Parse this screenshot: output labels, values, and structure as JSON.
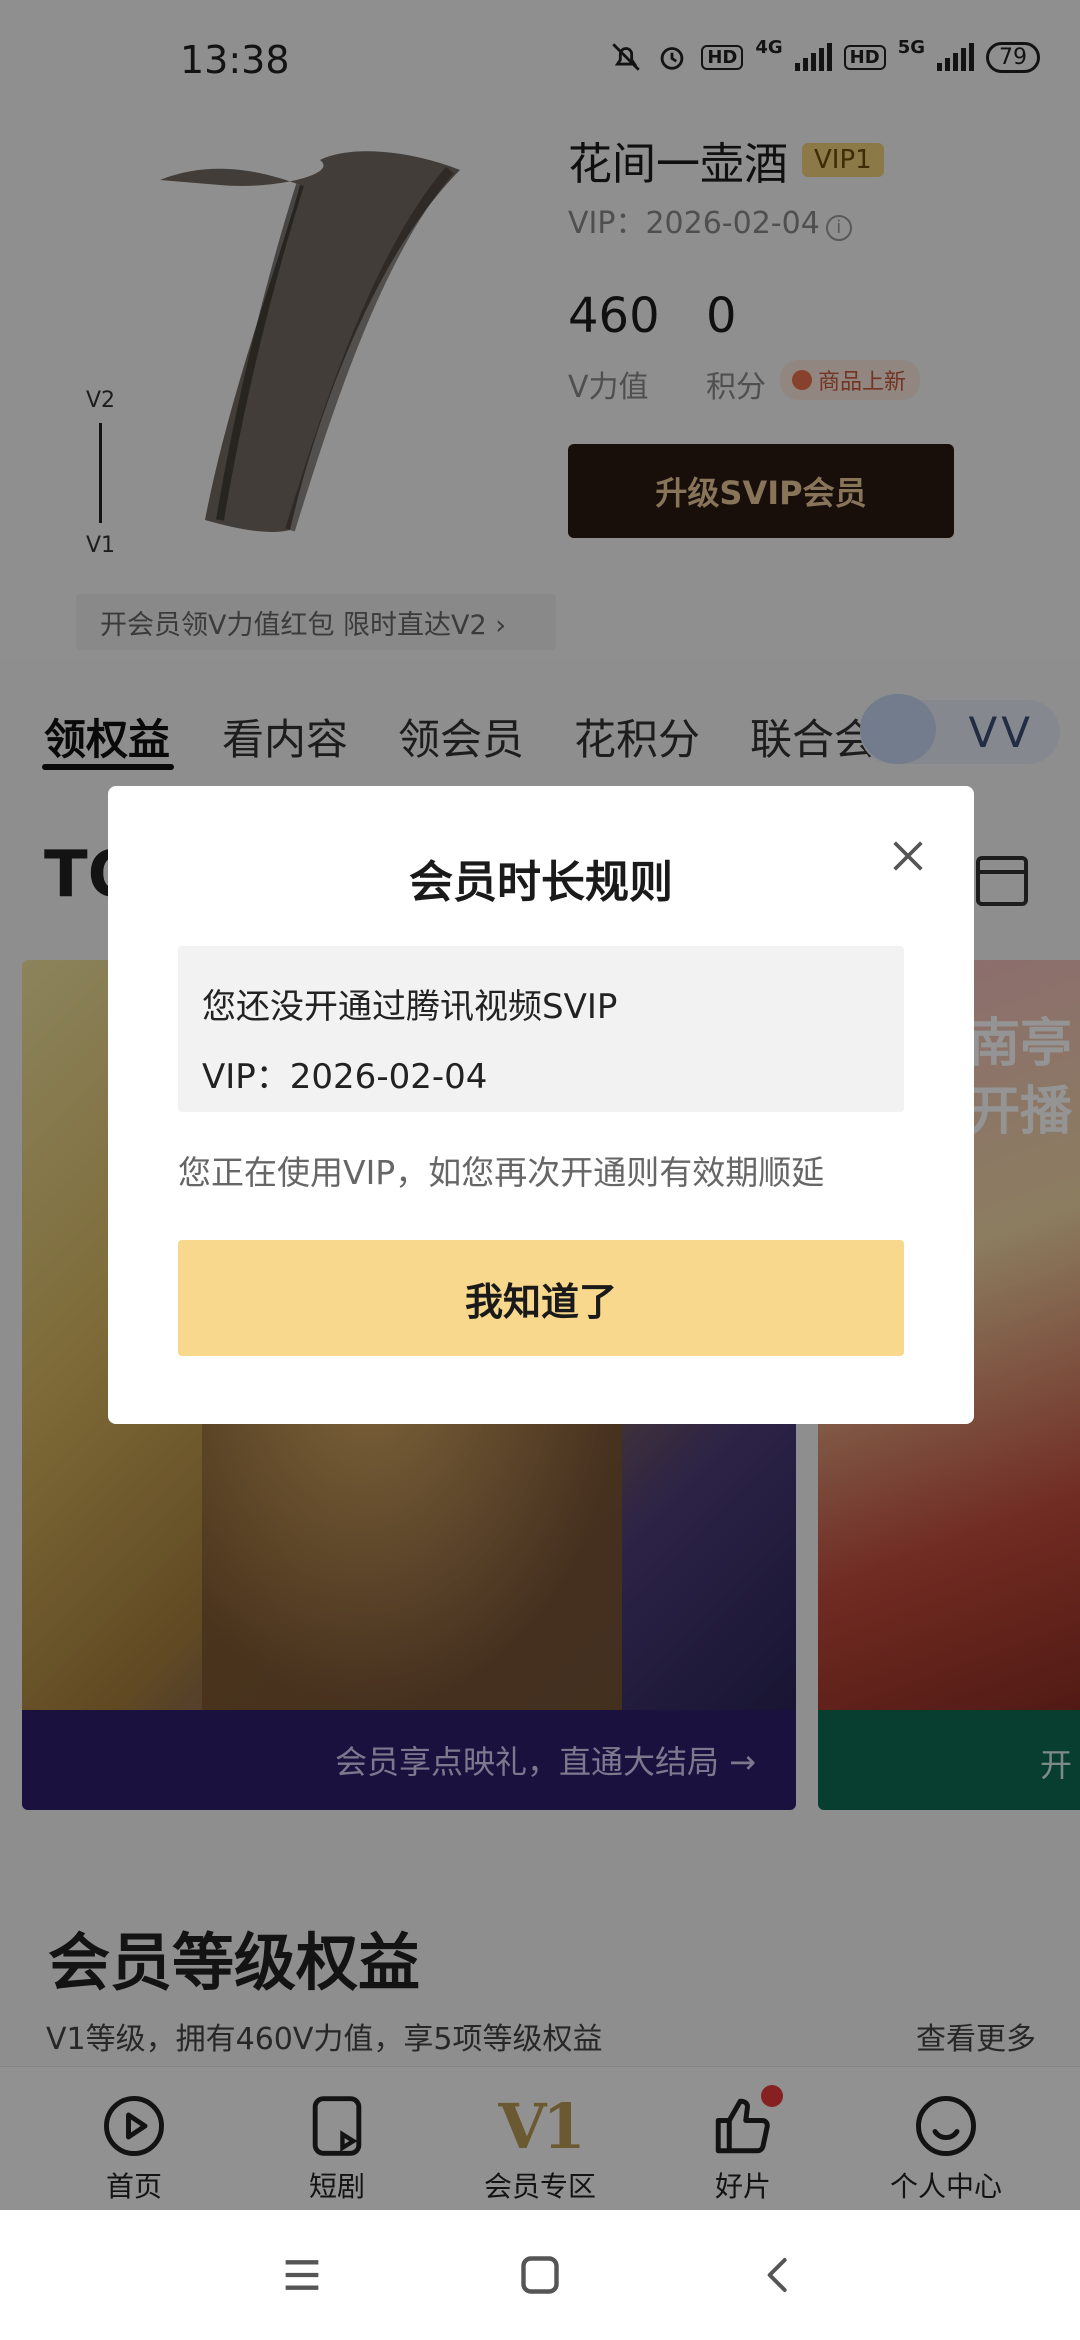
{
  "status_bar": {
    "time": "13:38",
    "network_a": "4G",
    "network_b": "5G",
    "hd_label": "HD",
    "battery": "79"
  },
  "header": {
    "username": "花间一壶酒",
    "vip_badge": "VIP1",
    "vip_expiry": "VIP：2026-02-04",
    "info_icon": "ⓘ",
    "level_scale_top": "V2",
    "level_scale_bottom": "V1",
    "v_power_value": "460",
    "v_power_label": "V力值",
    "points_value": "0",
    "points_label": "积分",
    "new_tag": "商品上新",
    "upgrade_button": "升级SVIP会员",
    "promo_text": "开会员领V力值红包 限时直达V2 ›"
  },
  "tabs": {
    "items": [
      "领权益",
      "看内容",
      "领会员",
      "花积分",
      "联合会"
    ],
    "active_index": 0,
    "vv_label": "VV"
  },
  "content": {
    "section_title": "TO",
    "card_left_banner": "会员享点映礼，直通大结局 →",
    "card_right_poster": "南亭开播",
    "card_right_banner": "开",
    "level_title": "会员等级权益",
    "level_subtitle": "V1等级，拥有460V力值，享5项等级权益",
    "view_more": "查看更多"
  },
  "bottom_nav": {
    "items": [
      {
        "label": "首页",
        "icon": "play-icon"
      },
      {
        "label": "短剧",
        "icon": "short-drama-icon"
      },
      {
        "label": "会员专区",
        "icon": "v1-icon",
        "glyph": "V1"
      },
      {
        "label": "好片",
        "icon": "thumbs-up-icon"
      },
      {
        "label": "个人中心",
        "icon": "smile-icon"
      }
    ],
    "active_index": 2
  },
  "modal": {
    "title": "会员时长规则",
    "info_line_1": "您还没开通过腾讯视频SVIP",
    "info_line_2": "VIP：2026-02-04",
    "note": "您正在使用VIP，如您再次开通则有效期顺延",
    "confirm_button": "我知道了"
  },
  "colors": {
    "accent_gold": "#f7d88c",
    "upgrade_button_bg": "#2b1a12",
    "upgrade_button_text": "#e9c89a",
    "vip_badge_bg": "#f0d27a",
    "nav_active": "#b99a56",
    "badge_red": "#e83a3a"
  }
}
